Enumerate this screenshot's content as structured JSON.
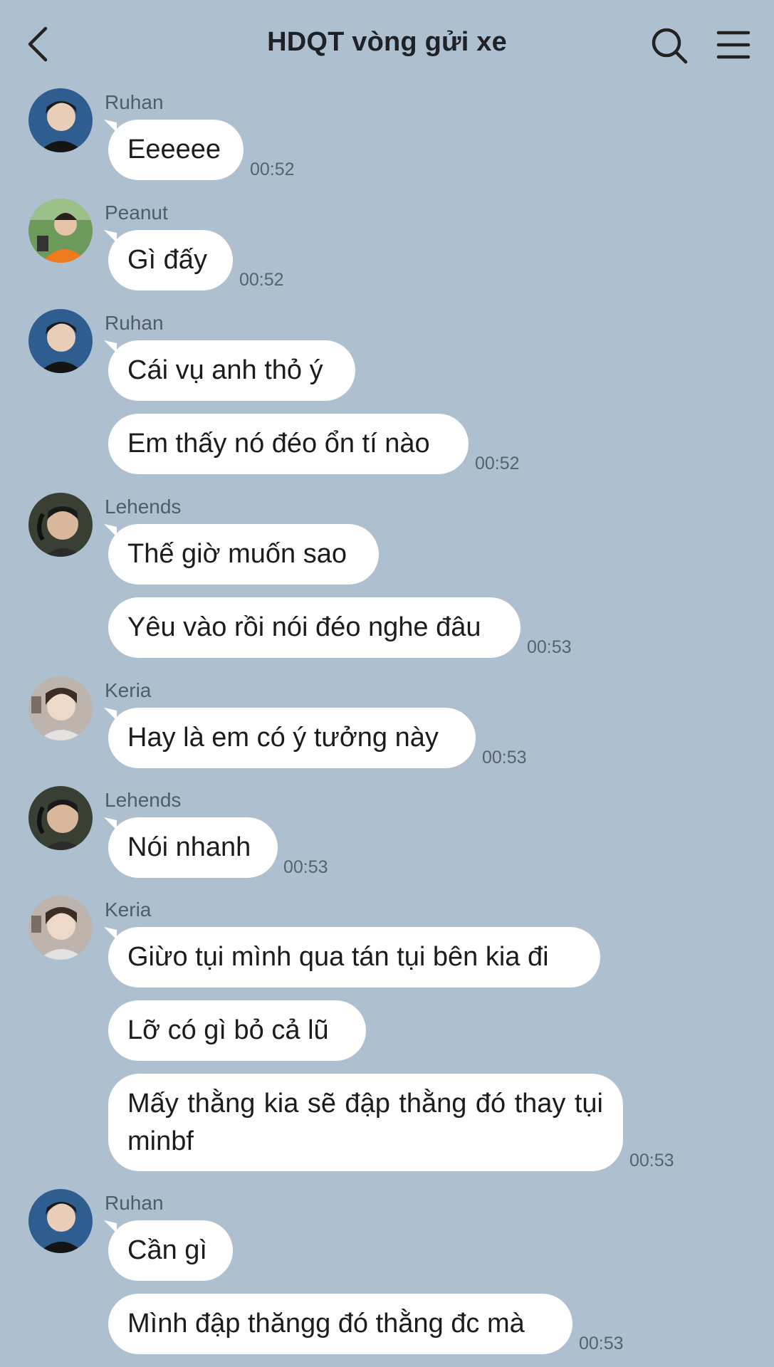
{
  "header": {
    "title": "HDQT vòng gửi xe",
    "back_icon": "chevron-left-icon",
    "search_icon": "search-icon",
    "menu_icon": "hamburger-menu-icon"
  },
  "messages": [
    {
      "sender": "Ruhan",
      "texts": [
        "Eeeeee"
      ],
      "time": "00:52"
    },
    {
      "sender": "Peanut",
      "texts": [
        "Gì đấy"
      ],
      "time": "00:52"
    },
    {
      "sender": "Ruhan",
      "texts": [
        "Cái vụ anh thỏ ý",
        "Em thấy nó đéo ổn tí nào"
      ],
      "time": "00:52"
    },
    {
      "sender": "Lehends",
      "texts": [
        "Thế giờ muốn sao",
        "Yêu vào rồi nói đéo nghe đâu"
      ],
      "time": "00:53"
    },
    {
      "sender": "Keria",
      "texts": [
        "Hay là em có ý tưởng này"
      ],
      "time": "00:53"
    },
    {
      "sender": "Lehends",
      "texts": [
        "Nói nhanh"
      ],
      "time": "00:53"
    },
    {
      "sender": "Keria",
      "texts": [
        "Giừo tụi mình qua tán tụi bên kia đi",
        "Lỡ có gì bỏ cả lũ",
        "Mấy thằng kia sẽ đập thằng đó thay tụi minbf"
      ],
      "time": "00:53"
    },
    {
      "sender": "Ruhan",
      "texts": [
        "Cần gì",
        "Mình đập thăngg đó thằng đc mà"
      ],
      "time": "00:53"
    }
  ],
  "colors": {
    "background": "#aebfd0",
    "bubble": "#ffffff",
    "text": "#1c1c1c",
    "timestamp": "#56636f"
  }
}
